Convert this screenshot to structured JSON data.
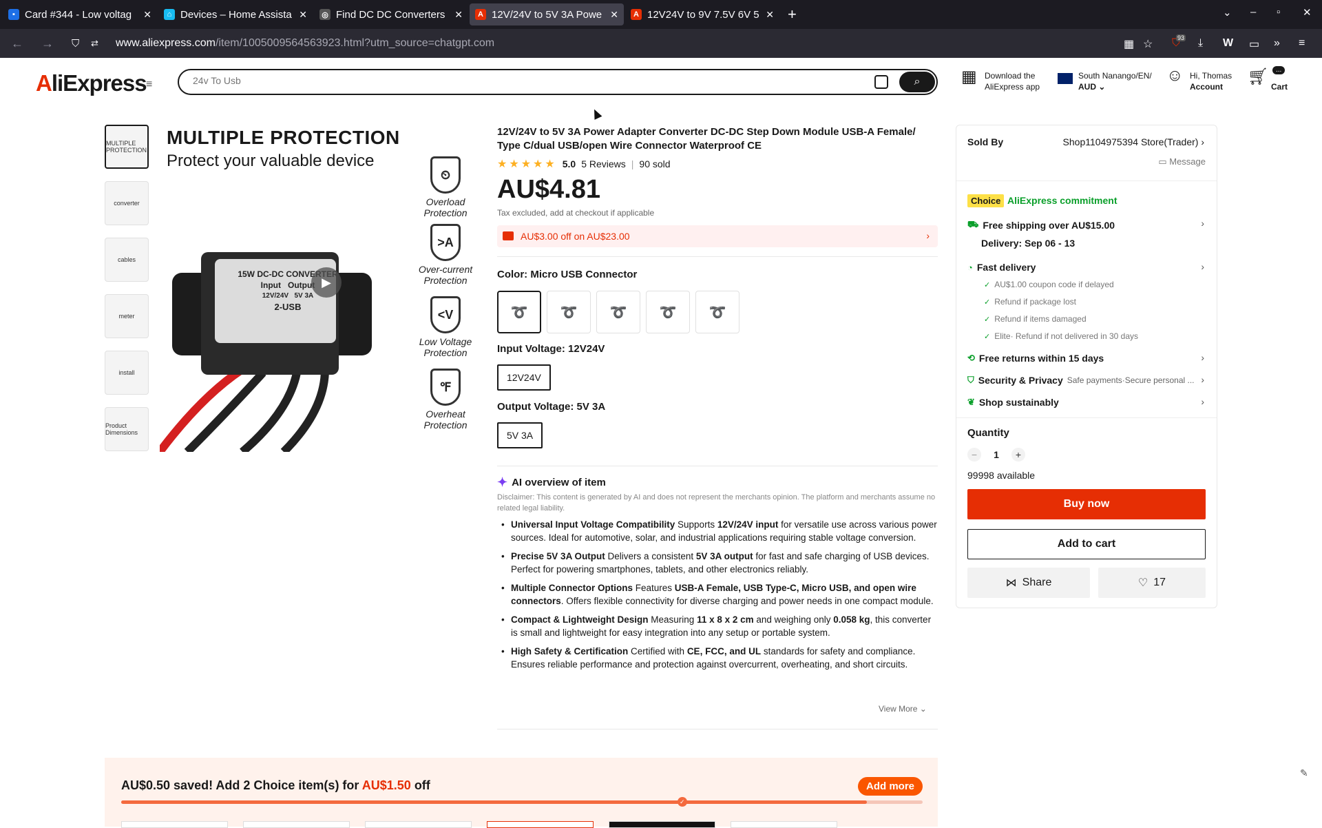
{
  "browser": {
    "tabs": [
      {
        "title": "Card #344 - Low voltag",
        "color": "#1d6fe6",
        "glyph": "▪"
      },
      {
        "title": "Devices – Home Assista",
        "color": "#18bcf2",
        "glyph": "⌂"
      },
      {
        "title": "Find DC DC Converters",
        "color": "#555",
        "glyph": "◎"
      },
      {
        "title": "12V/24V to 5V 3A Powe",
        "color": "#e62e04",
        "glyph": "A"
      },
      {
        "title": "12V24V to 9V 7.5V 6V 5",
        "color": "#e62e04",
        "glyph": "A"
      }
    ],
    "active_tab": 3,
    "url_host": "www.aliexpress.com",
    "url_rest": "/item/1005009564563923.html?utm_source=chatgpt.com",
    "ext_badge": "93"
  },
  "header": {
    "logo": "AliExpress",
    "search_value": "24v To Usb",
    "download_line1": "Download the",
    "download_line2": "AliExpress app",
    "region_line1": "South Nanango/EN/",
    "region_line2": "AUD",
    "account_line1": "Hi, Thomas",
    "account_line2": "Account",
    "cart_label": "Cart",
    "cart_badge": "..."
  },
  "gallery": {
    "thumbs": [
      "MULTIPLE PROTECTION",
      "converter",
      "cables",
      "meter",
      "install",
      "Product Dimensions"
    ],
    "title": "MULTIPLE PROTECTION",
    "subtitle": "Protect your valuable device",
    "device_label": "15W DC-DC CONVERTER",
    "device_in": "Input",
    "device_in_v": "12V/24V",
    "device_out": "Output",
    "device_out_v": "5V 3A",
    "device_type": "2-USB",
    "protections": [
      {
        "icon": "⏲",
        "label1": "Overload",
        "label2": "Protection"
      },
      {
        "icon": ">A",
        "label1": "Over-current",
        "label2": "Protection"
      },
      {
        "icon": "<V",
        "label1": "Low Voltage",
        "label2": "Protection"
      },
      {
        "icon": "℉",
        "label1": "Overheat",
        "label2": "Protection"
      }
    ]
  },
  "product": {
    "title": "12V/24V to 5V 3A Power Adapter Converter DC-DC Step Down Module USB-A Female/ Type C/dual USB/open Wire Connector Waterproof CE",
    "stars": "★★★★★",
    "rating": "5.0",
    "reviews": "5 Reviews",
    "sold": "90 sold",
    "price": "AU$4.81",
    "tax": "Tax excluded, add at checkout if applicable",
    "promo": "AU$3.00 off on AU$23.00",
    "color_label": "Color: Micro USB Connector",
    "input_label": "Input Voltage: 12V24V",
    "input_opt": "12V24V",
    "output_label": "Output Voltage: 5V 3A",
    "output_opt": "5V 3A"
  },
  "ai": {
    "heading": "AI overview of item",
    "disclaimer": "Disclaimer: This content is generated by AI and does not represent the merchants opinion. The platform and merchants assume no related legal liability.",
    "view_more": "View More ⌄"
  },
  "sidebar": {
    "sold_by": "Sold By",
    "store": "Shop1104975394 Store(Trader) ›",
    "message": "Message",
    "choice": "Choice",
    "commitment": "AliExpress commitment",
    "free_ship": "Free shipping over AU$15.00",
    "delivery": "Delivery: Sep 06 - 13",
    "fast": "Fast delivery",
    "checks": [
      "AU$1.00 coupon code if delayed",
      "Refund if package lost",
      "Refund if items damaged",
      "Elite· Refund if not delivered in 30 days"
    ],
    "returns": "Free returns within 15 days",
    "security": "Security & Privacy",
    "security_sub": "Safe payments·Secure personal ...",
    "sustain": "Shop sustainably",
    "qty_label": "Quantity",
    "qty_value": "1",
    "available": "99998 available",
    "buy": "Buy now",
    "add_cart": "Add to cart",
    "share": "Share",
    "wish_count": "17"
  },
  "bundle": {
    "text1": "AU$0.50 saved! Add 2 Choice item(s) for ",
    "text2": "AU$1.50",
    "text3": " off",
    "add_more": "Add more",
    "progress": 0.93,
    "marker": 0.7
  },
  "colors": {
    "accent": "#e62e04",
    "choice_green": "#0a9f2a",
    "ai_purple": "#7b3ff2"
  }
}
